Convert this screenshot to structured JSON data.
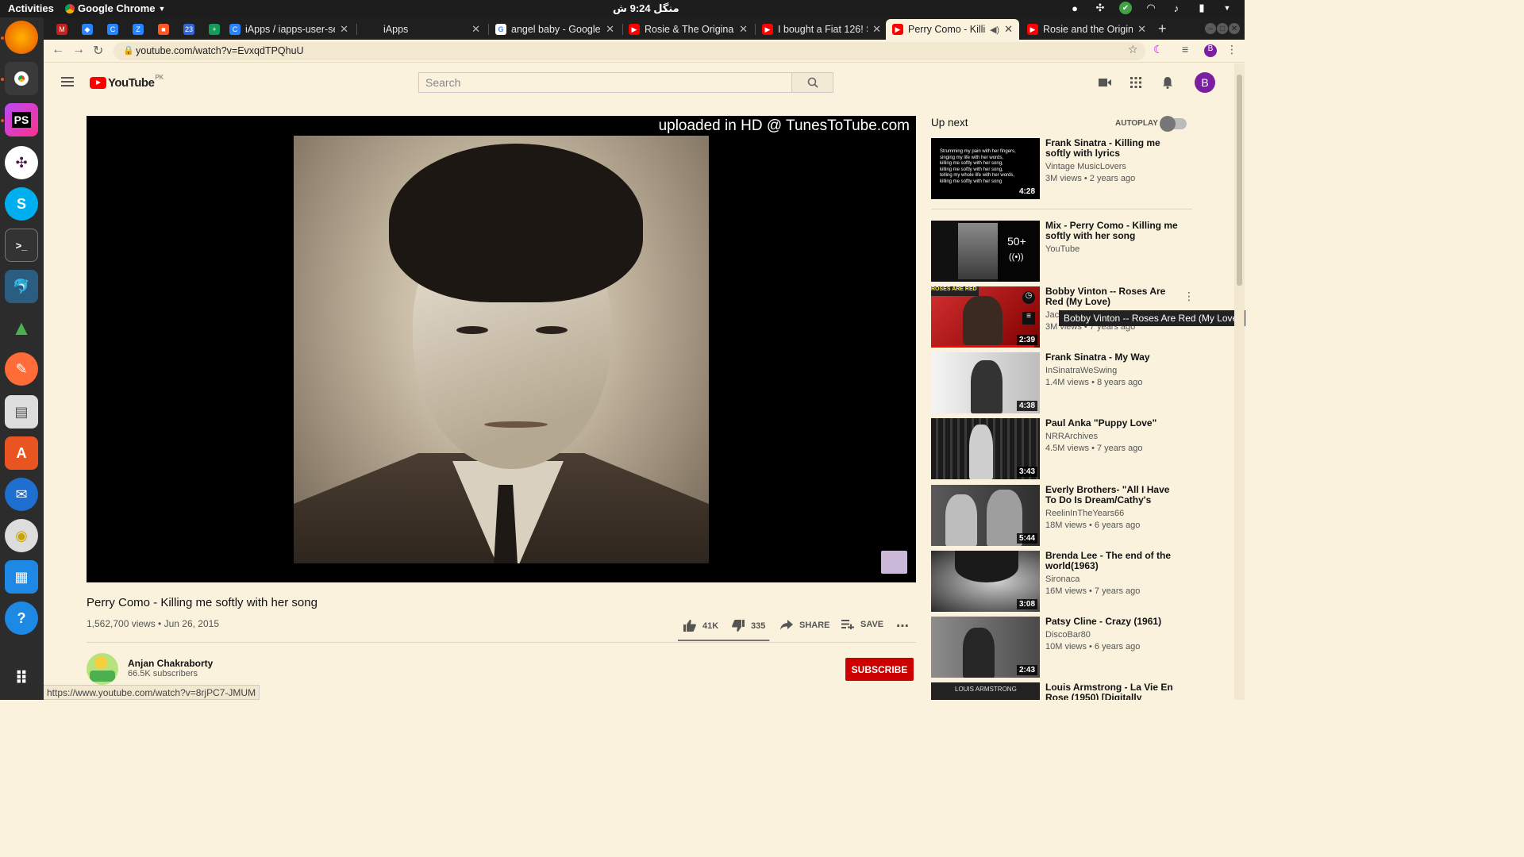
{
  "system": {
    "activities": "Activities",
    "app_menu": "Google Chrome",
    "clock": "منگل 9:24 ش"
  },
  "tabs": [
    {
      "label": "",
      "icon": "gmail-icon",
      "color": "#c5221f"
    },
    {
      "label": "",
      "icon": "jira-icon",
      "color": "#2684ff"
    },
    {
      "label": "",
      "icon": "confluence-icon",
      "color": "#2684ff"
    },
    {
      "label": "",
      "icon": "jira-icon",
      "color": "#2684ff"
    },
    {
      "label": "",
      "icon": "app-icon",
      "color": "#ff5722"
    },
    {
      "label": "",
      "icon": "calendar-icon",
      "color": "#3367d6"
    },
    {
      "label": "",
      "icon": "sheets-icon",
      "color": "#0f9d58"
    },
    {
      "label": "iApps / iapps-user-se",
      "icon": "bitbucket-icon",
      "color": "#2684ff"
    },
    {
      "label": "iApps",
      "icon": "",
      "color": ""
    },
    {
      "label": "angel baby - Google",
      "icon": "google-icon",
      "color": "#ffffff"
    },
    {
      "label": "Rosie & The Original",
      "icon": "youtube-icon",
      "color": "#ff0000"
    },
    {
      "label": "I bought a Fiat 126! S",
      "icon": "youtube-icon",
      "color": "#ff0000"
    },
    {
      "label": "Perry Como - Killi",
      "icon": "youtube-icon",
      "color": "#ff0000",
      "active": true
    },
    {
      "label": "Rosie and the Origin",
      "icon": "youtube-icon",
      "color": "#ff0000"
    }
  ],
  "address": {
    "url": "youtube.com/watch?v=EvxqdTPQhuU"
  },
  "youtube": {
    "logo_text": "YouTube",
    "country": "PK",
    "search_placeholder": "Search",
    "avatar_letter": "B"
  },
  "player": {
    "watermark": "uploaded in HD @ TunesToTube.com"
  },
  "video": {
    "title": "Perry Como - Killing me softly with her song",
    "meta": "1,562,700 views • Jun 26, 2015",
    "likes": "41K",
    "dislikes": "335",
    "like_fraction": 0.992,
    "share": "SHARE",
    "save": "SAVE",
    "channel": "Anjan Chakraborty",
    "subscribers": "66.5K subscribers",
    "subscribe": "SUBSCRIBE"
  },
  "status_url": "https://www.youtube.com/watch?v=8rjPC7-JMUM",
  "sidebar": {
    "up_next": "Up next",
    "autoplay": "AUTOPLAY",
    "tooltip": "Bobby Vinton -- Roses Are Red (My Love)",
    "thumb1_text": "Strumming my pain with her fingers,\nsinging my life with her words,\nkilling me softly with her song,\nkilling me softly with her song,\ntelling my whole life with her words,\nkilling me softly with her song",
    "mix_count": "50+",
    "items": [
      {
        "title": "Frank Sinatra - Killing me softly with lyrics",
        "channel": "Vintage MusicLovers",
        "stats": "3M views • 2 years ago",
        "duration": "4:28"
      },
      {
        "title": "Mix - Perry Como - Killing me softly with her song",
        "channel": "YouTube",
        "stats": "",
        "duration": ""
      },
      {
        "title": "Bobby Vinton -- Roses Are Red (My Love)",
        "channel": "Jac",
        "stats": "3M views • 7 years ago",
        "duration": "2:39",
        "progress": 0.95
      },
      {
        "title": "Frank Sinatra - My Way",
        "channel": "InSinatraWeSwing",
        "stats": "1.4M views • 8 years ago",
        "duration": "4:38"
      },
      {
        "title": "Paul Anka \"Puppy Love\"",
        "channel": "NRRArchives",
        "stats": "4.5M views • 7 years ago",
        "duration": "3:43"
      },
      {
        "title": "Everly Brothers- \"All I Have To Do Is Dream/Cathy's Clown\"...",
        "channel": "ReelinInTheYears66",
        "stats": "18M views • 6 years ago",
        "duration": "5:44"
      },
      {
        "title": "Brenda Lee - The end of the world(1963)",
        "channel": "Sironaca",
        "stats": "16M views • 7 years ago",
        "duration": "3:08"
      },
      {
        "title": "Patsy Cline - Crazy (1961)",
        "channel": "DiscoBar80",
        "stats": "10M views • 6 years ago",
        "duration": "2:43"
      },
      {
        "title": "Louis Armstrong - La Vie En Rose (1950) [Digitally",
        "channel": "",
        "stats": "",
        "duration": ""
      }
    ]
  }
}
